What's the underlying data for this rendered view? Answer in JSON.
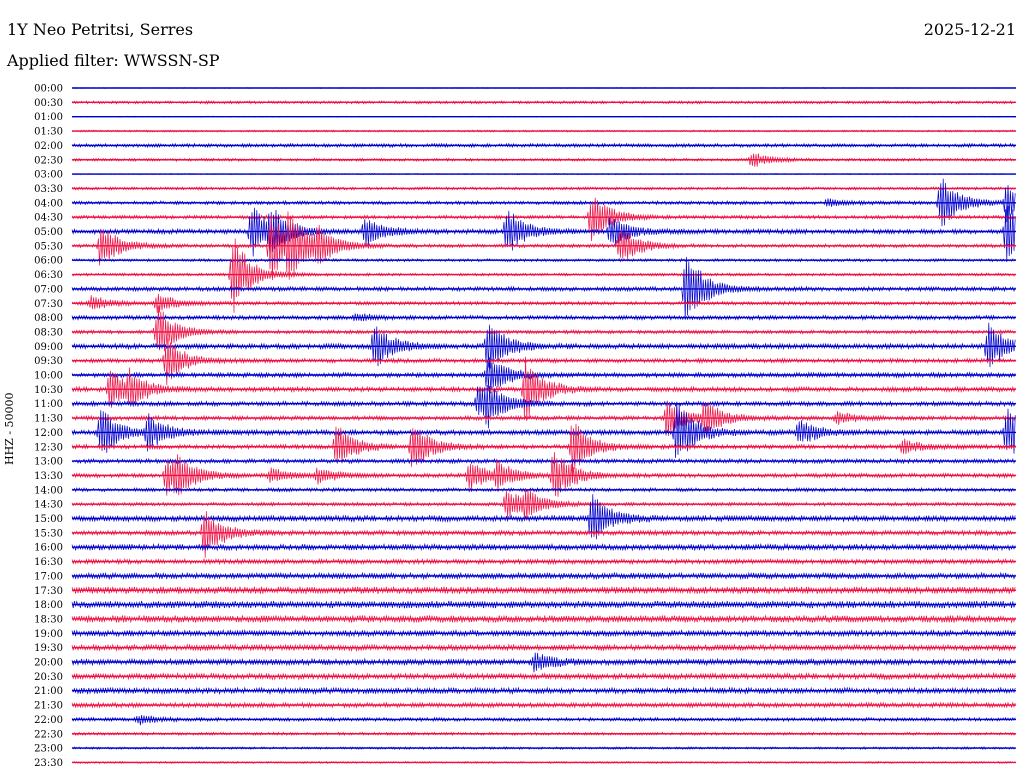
{
  "header": {
    "station": "1Y Neo Petritsi, Serres",
    "date": "2025-12-21",
    "filter": "Applied filter: WWSSN-SP"
  },
  "chart_data": {
    "type": "line",
    "ylabel": "HHZ - 50000",
    "row_labels": [
      "00:00",
      "00:30",
      "01:00",
      "01:30",
      "02:00",
      "02:30",
      "03:00",
      "03:30",
      "04:00",
      "04:30",
      "05:00",
      "05:30",
      "06:00",
      "06:30",
      "07:00",
      "07:30",
      "08:00",
      "08:30",
      "09:00",
      "09:30",
      "10:00",
      "10:30",
      "11:00",
      "11:30",
      "12:00",
      "12:30",
      "13:00",
      "13:30",
      "14:00",
      "14:30",
      "15:00",
      "15:30",
      "16:00",
      "16:30",
      "17:00",
      "17:30",
      "18:00",
      "18:30",
      "19:00",
      "19:30",
      "20:00",
      "20:30",
      "21:00",
      "21:30",
      "22:00",
      "22:30",
      "23:00",
      "23:30"
    ],
    "row_interval_minutes": 30,
    "colors": [
      "#0000cc",
      "#ee1144"
    ],
    "noise_level": [
      0.4,
      1.2,
      0.4,
      0.8,
      1.5,
      1.2,
      0.5,
      1.2,
      1.5,
      1.5,
      2.0,
      1.5,
      1.2,
      1.2,
      1.8,
      1.5,
      1.8,
      1.5,
      2.2,
      1.8,
      2.0,
      2.0,
      2.0,
      1.8,
      2.2,
      1.8,
      1.8,
      1.8,
      1.5,
      1.5,
      2.5,
      2.0,
      2.5,
      2.0,
      2.5,
      3.0,
      3.0,
      3.0,
      2.5,
      2.5,
      2.5,
      2.5,
      2.5,
      2.0,
      1.5,
      1.2,
      1.0,
      0.8
    ],
    "events": [
      {
        "row": 5,
        "x": 0.72,
        "amp": 8
      },
      {
        "row": 8,
        "x": 0.8,
        "amp": 4
      },
      {
        "row": 8,
        "x": 0.92,
        "amp": 28
      },
      {
        "row": 8,
        "x": 0.99,
        "amp": 22
      },
      {
        "row": 9,
        "x": 0.55,
        "amp": 28
      },
      {
        "row": 10,
        "x": 0.19,
        "amp": 28
      },
      {
        "row": 10,
        "x": 0.21,
        "amp": 20
      },
      {
        "row": 10,
        "x": 0.31,
        "amp": 16
      },
      {
        "row": 10,
        "x": 0.46,
        "amp": 26
      },
      {
        "row": 10,
        "x": 0.57,
        "amp": 18
      },
      {
        "row": 10,
        "x": 0.99,
        "amp": 36
      },
      {
        "row": 11,
        "x": 0.03,
        "amp": 24
      },
      {
        "row": 11,
        "x": 0.21,
        "amp": 40
      },
      {
        "row": 11,
        "x": 0.23,
        "amp": 32
      },
      {
        "row": 11,
        "x": 0.26,
        "amp": 16
      },
      {
        "row": 11,
        "x": 0.58,
        "amp": 22
      },
      {
        "row": 13,
        "x": 0.17,
        "amp": 42
      },
      {
        "row": 14,
        "x": 0.65,
        "amp": 42
      },
      {
        "row": 15,
        "x": 0.02,
        "amp": 8
      },
      {
        "row": 15,
        "x": 0.09,
        "amp": 10
      },
      {
        "row": 16,
        "x": 0.3,
        "amp": 4
      },
      {
        "row": 17,
        "x": 0.09,
        "amp": 28
      },
      {
        "row": 18,
        "x": 0.32,
        "amp": 24
      },
      {
        "row": 18,
        "x": 0.44,
        "amp": 30
      },
      {
        "row": 18,
        "x": 0.97,
        "amp": 24
      },
      {
        "row": 19,
        "x": 0.1,
        "amp": 24
      },
      {
        "row": 20,
        "x": 0.44,
        "amp": 22
      },
      {
        "row": 21,
        "x": 0.04,
        "amp": 24
      },
      {
        "row": 21,
        "x": 0.06,
        "amp": 14
      },
      {
        "row": 21,
        "x": 0.48,
        "amp": 34
      },
      {
        "row": 22,
        "x": 0.43,
        "amp": 18
      },
      {
        "row": 22,
        "x": 0.44,
        "amp": 14
      },
      {
        "row": 23,
        "x": 0.63,
        "amp": 20
      },
      {
        "row": 23,
        "x": 0.67,
        "amp": 18
      },
      {
        "row": 23,
        "x": 0.81,
        "amp": 6
      },
      {
        "row": 24,
        "x": 0.03,
        "amp": 28
      },
      {
        "row": 24,
        "x": 0.08,
        "amp": 18
      },
      {
        "row": 24,
        "x": 0.64,
        "amp": 36
      },
      {
        "row": 24,
        "x": 0.77,
        "amp": 14
      },
      {
        "row": 24,
        "x": 0.99,
        "amp": 30
      },
      {
        "row": 25,
        "x": 0.28,
        "amp": 24
      },
      {
        "row": 25,
        "x": 0.36,
        "amp": 26
      },
      {
        "row": 25,
        "x": 0.53,
        "amp": 30
      },
      {
        "row": 25,
        "x": 0.88,
        "amp": 8
      },
      {
        "row": 27,
        "x": 0.1,
        "amp": 20
      },
      {
        "row": 27,
        "x": 0.11,
        "amp": 16
      },
      {
        "row": 27,
        "x": 0.21,
        "amp": 8
      },
      {
        "row": 27,
        "x": 0.26,
        "amp": 8
      },
      {
        "row": 27,
        "x": 0.42,
        "amp": 16
      },
      {
        "row": 27,
        "x": 0.45,
        "amp": 14
      },
      {
        "row": 27,
        "x": 0.51,
        "amp": 28
      },
      {
        "row": 29,
        "x": 0.46,
        "amp": 16
      },
      {
        "row": 29,
        "x": 0.48,
        "amp": 14
      },
      {
        "row": 30,
        "x": 0.55,
        "amp": 26
      },
      {
        "row": 31,
        "x": 0.14,
        "amp": 26
      },
      {
        "row": 40,
        "x": 0.49,
        "amp": 10
      },
      {
        "row": 44,
        "x": 0.07,
        "amp": 5
      }
    ]
  }
}
